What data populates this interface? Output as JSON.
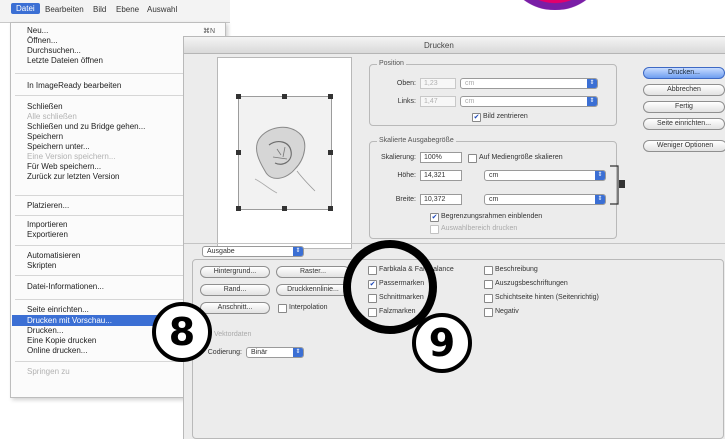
{
  "menubar": {
    "items": [
      "Datei",
      "Bearbeiten",
      "Bild",
      "Ebene",
      "Auswahl"
    ]
  },
  "file_menu": {
    "items": [
      {
        "label": "Neu...",
        "shortcut": "⌘N"
      },
      {
        "label": "Öffnen..."
      },
      {
        "label": "Durchsuchen..."
      },
      {
        "label": "Letzte Dateien öffnen"
      },
      {
        "label": "In ImageReady bearbeiten"
      },
      {
        "label": "Schließen"
      },
      {
        "label": "Alle schließen",
        "disabled": true
      },
      {
        "label": "Schließen und zu Bridge gehen..."
      },
      {
        "label": "Speichern"
      },
      {
        "label": "Speichern unter..."
      },
      {
        "label": "Eine Version speichern...",
        "disabled": true
      },
      {
        "label": "Für Web speichern..."
      },
      {
        "label": "Zurück zur letzten Version"
      },
      {
        "label": "Platzieren..."
      },
      {
        "label": "Importieren"
      },
      {
        "label": "Exportieren"
      },
      {
        "label": "Automatisieren"
      },
      {
        "label": "Skripten"
      },
      {
        "label": "Datei-Informationen..."
      },
      {
        "label": "Seite einrichten..."
      },
      {
        "label": "Drucken mit Vorschau..."
      },
      {
        "label": "Drucken..."
      },
      {
        "label": "Eine Kopie drucken"
      },
      {
        "label": "Online drucken..."
      },
      {
        "label": "Springen zu",
        "disabled": true
      }
    ]
  },
  "dialog": {
    "title": "Drucken",
    "position": {
      "group_label": "Position",
      "oben_label": "Oben:",
      "oben_value": "1,23",
      "oben_unit": "cm",
      "links_label": "Links:",
      "links_value": "1,47",
      "links_unit": "cm",
      "center_label": "Bild zentrieren",
      "center_checked": true
    },
    "scaled": {
      "group_label": "Skalierte Ausgabegröße",
      "skalierung_label": "Skalierung:",
      "skalierung_value": "100%",
      "fit_label": "Auf Mediengröße skalieren",
      "hoehe_label": "Höhe:",
      "hoehe_value": "14,321",
      "hoehe_unit": "cm",
      "breite_label": "Breite:",
      "breite_value": "10,372",
      "breite_unit": "cm",
      "bbox_label": "Begrenzungsrahmen einblenden",
      "bbox_checked": true,
      "selection_label": "Auswahlbereich drucken"
    },
    "buttons": {
      "print": "Drucken...",
      "cancel": "Abbrechen",
      "done": "Fertig",
      "page_setup": "Seite einrichten...",
      "fewer_options": "Weniger Optionen"
    },
    "output": {
      "popup": "Ausgabe",
      "btn_background": "Hintergrund...",
      "btn_border": "Rand...",
      "btn_bleed": "Anschnitt...",
      "btn_screen": "Raster...",
      "btn_transfer": "Druckkennlinie...",
      "interpolate_label": "Interpolation",
      "checkboxes_left": [
        {
          "label": "Farbkala & Farbbalance",
          "checked": false
        },
        {
          "label": "Passermarken",
          "checked": true
        },
        {
          "label": "Schnittmarken",
          "checked": false
        },
        {
          "label": "Falzmarken",
          "checked": false
        }
      ],
      "checkboxes_right": [
        {
          "label": "Beschreibung",
          "checked": false
        },
        {
          "label": "Auszugsbeschriftungen",
          "checked": false
        },
        {
          "label": "Schichtseite hinten (Seitenrichtig)",
          "checked": false
        },
        {
          "label": "Negativ",
          "checked": false
        }
      ],
      "vector_label": "Vektordaten",
      "encoding_label": "Codierung:",
      "encoding_value": "Binär"
    }
  },
  "markers": {
    "eight": "8",
    "nine": "9"
  }
}
